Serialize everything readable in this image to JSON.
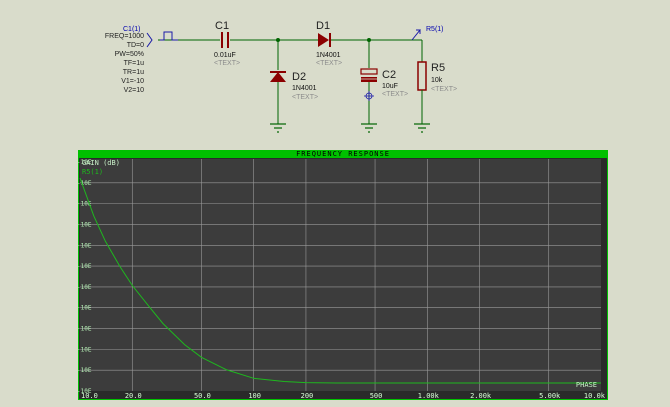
{
  "schematic": {
    "source": {
      "name": "C1(1)",
      "params": [
        "FREQ=1000",
        "TD=0",
        "PW=50%",
        "TF=1u",
        "TR=1u",
        "V1=-10",
        "V2=10"
      ]
    },
    "c1": {
      "ref": "C1",
      "value": "0.01uF",
      "text": "<TEXT>"
    },
    "d1": {
      "ref": "D1",
      "value": "1N4001",
      "text": "<TEXT>"
    },
    "d2": {
      "ref": "D2",
      "value": "1N4001",
      "text": "<TEXT>"
    },
    "c2": {
      "ref": "C2",
      "value": "10uF",
      "text": "<TEXT>"
    },
    "r5": {
      "ref": "R5",
      "value": "10k",
      "text": "<TEXT>"
    },
    "probe": {
      "label": "R5(1)"
    }
  },
  "graph": {
    "title": "FREQUENCY RESPONSE",
    "left_axis_label": "GAIN (dB)",
    "right_axis_label": "PHASE",
    "colors": {
      "frame": "#00c000",
      "plot_bg": "#3c3c3c",
      "grid": "#9a9a9a",
      "trace": "#1eb81e"
    }
  },
  "chart_data": {
    "type": "line",
    "title": "FREQUENCY RESPONSE",
    "ylabel": "GAIN (dB)",
    "y2label": "PHASE",
    "xscale": "log",
    "xlim": [
      10,
      10000
    ],
    "ylim": [
      0,
      11
    ],
    "x_tick_labels": [
      "10.0",
      "20.0",
      "50.0",
      "100",
      "200",
      "500",
      "1.00k",
      "2.00k",
      "5.00k",
      "10.0k"
    ],
    "x_tick_values": [
      10,
      20,
      50,
      100,
      200,
      500,
      1000,
      2000,
      5000,
      10000
    ],
    "y_tick_labels": [
      "-10E",
      "-10E",
      "-10E",
      "-10E",
      "-10E",
      "-10E",
      "-10E",
      "-10E",
      "-10E",
      "-10E",
      "-10E",
      "-10E"
    ],
    "series": [
      {
        "name": "R5(1)",
        "color": "#1eb81e",
        "x": [
          10,
          12,
          14,
          17,
          20,
          25,
          30,
          40,
          50,
          70,
          100,
          150,
          200,
          300,
          500,
          1000,
          2000,
          5000,
          10000
        ],
        "y": [
          10.1,
          8.3,
          7.1,
          5.9,
          5.0,
          4.0,
          3.2,
          2.2,
          1.6,
          1.0,
          0.6,
          0.45,
          0.4,
          0.38,
          0.38,
          0.38,
          0.38,
          0.38,
          0.38
        ]
      }
    ]
  }
}
